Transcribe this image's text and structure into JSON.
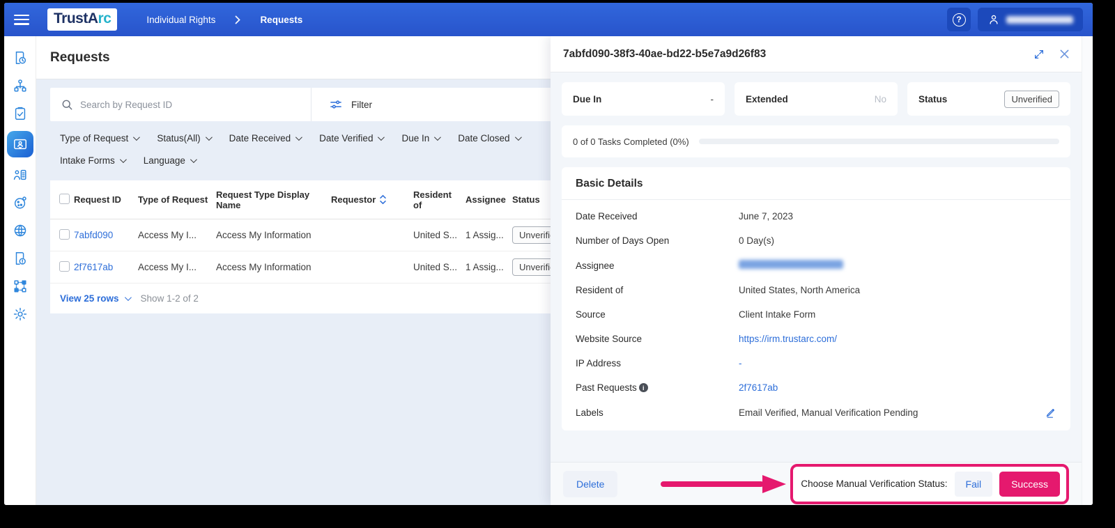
{
  "header": {
    "logo_primary": "TrustA",
    "logo_accent": "rc",
    "breadcrumb": [
      "Individual Rights",
      "Requests"
    ],
    "help_glyph": "?"
  },
  "sidebar": {
    "items": [
      "reports-icon",
      "org-map-icon",
      "tasks-icon",
      "requests-icon",
      "contacts-icon",
      "cookies-icon",
      "intelligence-icon",
      "incidents-icon",
      "workflow-icon",
      "settings-icon"
    ],
    "active_item": "requests-icon"
  },
  "main": {
    "title": "Requests",
    "search_placeholder": "Search by Request ID",
    "filter_label": "Filter",
    "filters_row1": [
      "Type of Request",
      "Status(All)",
      "Date Received",
      "Date Verified",
      "Due In",
      "Date Closed"
    ],
    "filters_row2": [
      "Intake Forms",
      "Language"
    ],
    "table": {
      "columns": [
        "Request ID",
        "Type of Request",
        "Request Type Display Name",
        "Requestor",
        "Resident of",
        "Assignee",
        "Status"
      ],
      "rows": [
        {
          "id": "7abfd090",
          "type": "Access My I...",
          "display_name": "Access My Information",
          "resident": "United S...",
          "assignee": "1 Assig...",
          "status": "Unverified"
        },
        {
          "id": "2f7617ab",
          "type": "Access My I...",
          "display_name": "Access My Information",
          "resident": "United S...",
          "assignee": "1 Assig...",
          "status": "Unverified"
        }
      ],
      "view_rows_label": "View 25 rows",
      "showing_label": "Show 1-2 of 2"
    }
  },
  "panel": {
    "title": "7abfd090-38f3-40ae-bd22-b5e7a9d26f83",
    "summary_cards": [
      {
        "label": "Due In",
        "value": "-"
      },
      {
        "label": "Extended",
        "value": "No"
      },
      {
        "label": "Status",
        "value": "Unverified"
      }
    ],
    "progress_text": "0 of 0 Tasks Completed (0%)",
    "progress_percent": 0,
    "basic_details": {
      "title": "Basic Details",
      "rows": [
        {
          "label": "Date Received",
          "value": "June 7, 2023"
        },
        {
          "label": "Number of Days Open",
          "value": "0 Day(s)"
        },
        {
          "label": "Assignee",
          "value": ""
        },
        {
          "label": "Resident of",
          "value": "United States, North America"
        },
        {
          "label": "Source",
          "value": "Client Intake Form"
        },
        {
          "label": "Website Source",
          "value": "https://irm.trustarc.com/"
        },
        {
          "label": "IP Address",
          "value": "-"
        },
        {
          "label": "Past Requests",
          "value": "2f7617ab"
        },
        {
          "label": "Labels",
          "value": "Email Verified, Manual Verification Pending"
        }
      ],
      "info_glyph": "i"
    },
    "footer": {
      "delete_label": "Delete",
      "prompt": "Choose Manual Verification Status:",
      "fail_label": "Fail",
      "success_label": "Success"
    }
  },
  "colors": {
    "header_blue": "#2b5ccf",
    "accent_blue": "#2d6ed9",
    "logo_teal": "#25b3cb",
    "highlight_pink": "#e5196e",
    "content_bg": "#e8eef7"
  }
}
